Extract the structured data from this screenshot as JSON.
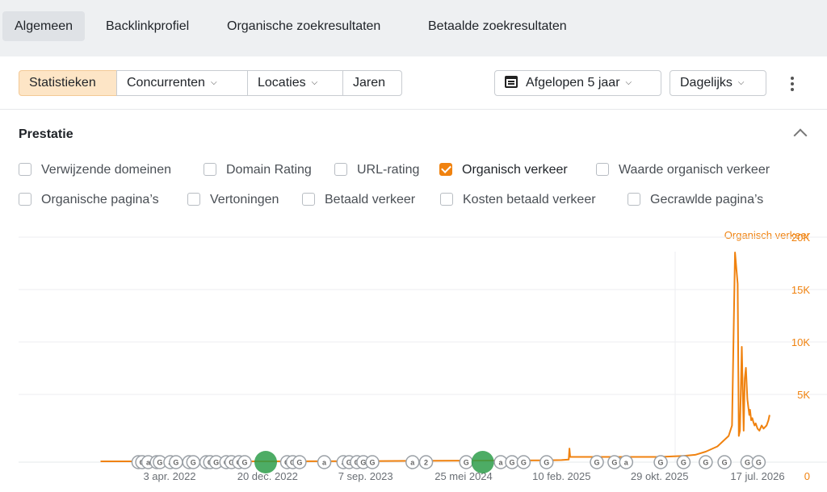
{
  "top_tabs": [
    "Algemeen",
    "Backlinkprofiel",
    "Organische zoekresultaten",
    "Betaalde zoekresultaten"
  ],
  "toolbar": {
    "segments": [
      "Statistieken",
      "Concurrenten",
      "Locaties",
      "Jaren"
    ],
    "period": "Afgelopen 5 jaar",
    "interval": "Dagelijks"
  },
  "section": {
    "title": "Prestatie",
    "checkboxes": [
      {
        "label": "Verwijzende domeinen",
        "checked": false
      },
      {
        "label": "Domain Rating",
        "checked": false
      },
      {
        "label": "URL-rating",
        "checked": false
      },
      {
        "label": "Organisch verkeer",
        "checked": true
      },
      {
        "label": "Waarde organisch verkeer",
        "checked": false
      },
      {
        "label": "Organische pagina’s",
        "checked": false
      },
      {
        "label": "Vertoningen",
        "checked": false
      },
      {
        "label": "Betaald verkeer",
        "checked": false
      },
      {
        "label": "Kosten betaald verkeer",
        "checked": false
      },
      {
        "label": "Gecrawlde pagina’s",
        "checked": false
      }
    ]
  },
  "colors": {
    "accent": "#f0820f",
    "update_marker": "#2e9d4a"
  },
  "chart_data": {
    "type": "line",
    "series": [
      {
        "name": "Organisch verkeer",
        "x": [
          "2021-10-01",
          "2022-04-03",
          "2022-12-20",
          "2023-09-07",
          "2024-05-25",
          "2025-01-01",
          "2025-02-10",
          "2025-03-01",
          "2025-03-03",
          "2025-03-05",
          "2025-04-01",
          "2025-06-01",
          "2025-08-01",
          "2025-10-29",
          "2026-01-01",
          "2026-02-01",
          "2026-03-01",
          "2026-04-01",
          "2026-05-01",
          "2026-05-10",
          "2026-05-18",
          "2026-05-25",
          "2026-05-28",
          "2026-05-31",
          "2026-06-05",
          "2026-06-10",
          "2026-06-13",
          "2026-06-16",
          "2026-06-20",
          "2026-06-25",
          "2026-06-27",
          "2026-06-30",
          "2026-07-03",
          "2026-07-06",
          "2026-07-09",
          "2026-07-12",
          "2026-07-17",
          "2026-07-22",
          "2026-07-28",
          "2026-08-02",
          "2026-08-10",
          "2026-08-15",
          "2026-08-18"
        ],
        "values": [
          50,
          50,
          60,
          100,
          150,
          180,
          200,
          250,
          1300,
          500,
          500,
          500,
          500,
          500,
          600,
          700,
          1000,
          1500,
          2500,
          3500,
          20000,
          17000,
          2500,
          3000,
          11000,
          3000,
          8000,
          9000,
          6000,
          4500,
          5000,
          4000,
          4200,
          3800,
          3500,
          3700,
          3200,
          3000,
          3500,
          3200,
          3500,
          4000,
          4500
        ]
      }
    ],
    "x_ticks": [
      "3 apr. 2022",
      "20 dec. 2022",
      "7 sep. 2023",
      "25 mei 2024",
      "10 feb. 2025",
      "29 okt. 2025",
      "17 jul. 2026"
    ],
    "x_tick_dates": [
      "2022-04-03",
      "2022-12-20",
      "2023-09-07",
      "2024-05-25",
      "2025-02-10",
      "2025-10-29",
      "2026-07-17"
    ],
    "xlim": [
      "2021-10-01",
      "2026-09-01"
    ],
    "y_ticks": [
      "0",
      "5K",
      "10K",
      "15K",
      "20K"
    ],
    "y_tick_values": [
      0,
      5000,
      10000,
      15000,
      20000
    ],
    "ylim": [
      0,
      20000
    ],
    "y_axis_title": "Organisch verkeer",
    "y_axis_side": "right",
    "grid": true,
    "event_markers": [
      {
        "date": "2022-01-10",
        "label": "G"
      },
      {
        "date": "2022-01-20",
        "label": "G"
      },
      {
        "date": "2022-02-05",
        "label": "a"
      },
      {
        "date": "2022-02-28",
        "label": "G"
      },
      {
        "date": "2022-03-08",
        "label": "G"
      },
      {
        "date": "2022-04-05",
        "label": "a"
      },
      {
        "date": "2022-04-20",
        "label": "G"
      },
      {
        "date": "2022-05-25",
        "label": "G"
      },
      {
        "date": "2022-06-05",
        "label": "G"
      },
      {
        "date": "2022-07-10",
        "label": "a"
      },
      {
        "date": "2022-07-20",
        "label": "G"
      },
      {
        "date": "2022-08-05",
        "label": "G"
      },
      {
        "date": "2022-09-01",
        "label": "G"
      },
      {
        "date": "2022-09-15",
        "label": "G"
      },
      {
        "date": "2022-10-05",
        "label": "G"
      },
      {
        "date": "2022-10-20",
        "label": "G"
      },
      {
        "date": "2022-12-15",
        "label": "G",
        "big": true
      },
      {
        "date": "2023-02-10",
        "label": "G"
      },
      {
        "date": "2023-02-25",
        "label": "G"
      },
      {
        "date": "2023-03-15",
        "label": "G"
      },
      {
        "date": "2023-05-20",
        "label": "a"
      },
      {
        "date": "2023-07-10",
        "label": "a"
      },
      {
        "date": "2023-07-25",
        "label": "G"
      },
      {
        "date": "2023-08-15",
        "label": "G"
      },
      {
        "date": "2023-09-01",
        "label": "G"
      },
      {
        "date": "2023-09-25",
        "label": "G"
      },
      {
        "date": "2024-01-10",
        "label": "a"
      },
      {
        "date": "2024-02-15",
        "label": "2"
      },
      {
        "date": "2024-06-01",
        "label": "G"
      },
      {
        "date": "2024-07-15",
        "label": "G",
        "big": true
      },
      {
        "date": "2024-09-01",
        "label": "a"
      },
      {
        "date": "2024-10-01",
        "label": "G"
      },
      {
        "date": "2024-11-01",
        "label": "G"
      },
      {
        "date": "2025-01-01",
        "label": "G"
      },
      {
        "date": "2025-05-15",
        "label": "G"
      },
      {
        "date": "2025-07-01",
        "label": "G"
      },
      {
        "date": "2025-08-01",
        "label": "a"
      },
      {
        "date": "2025-11-01",
        "label": "G"
      },
      {
        "date": "2026-01-01",
        "label": "G"
      },
      {
        "date": "2026-03-01",
        "label": "G"
      },
      {
        "date": "2026-04-20",
        "label": "G"
      },
      {
        "date": "2026-06-20",
        "label": "G"
      },
      {
        "date": "2026-07-20",
        "label": "G"
      }
    ]
  }
}
